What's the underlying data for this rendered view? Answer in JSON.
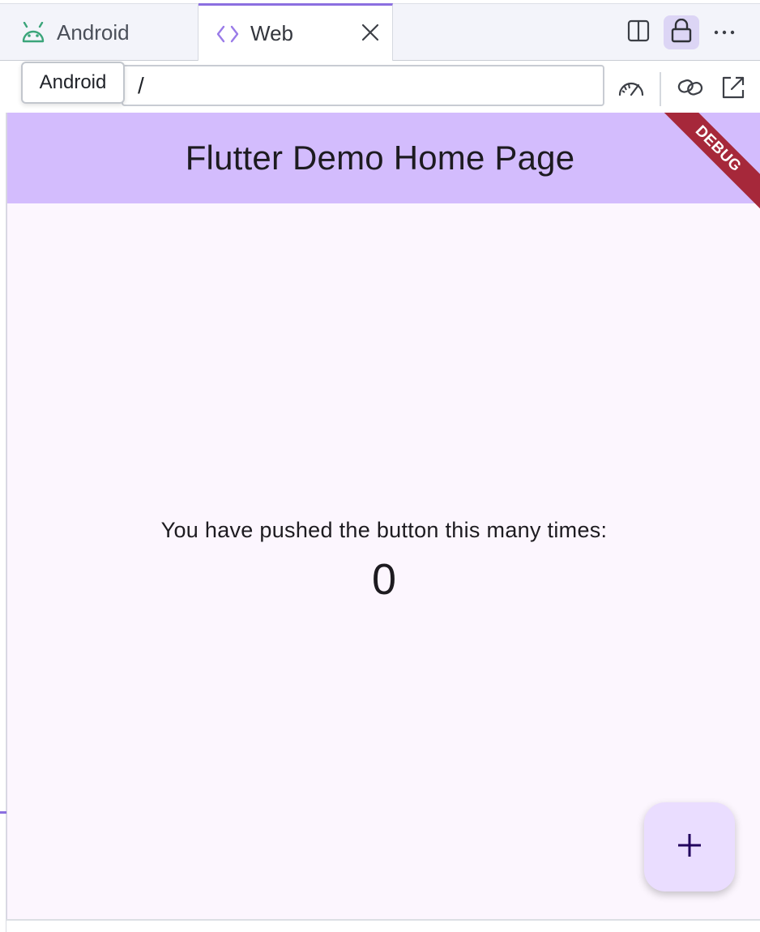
{
  "tabs": [
    {
      "label": "Android",
      "icon": "android-icon",
      "active": false
    },
    {
      "label": "Web",
      "icon": "code-brackets-icon",
      "active": true
    }
  ],
  "toolbar": {
    "icons": [
      "split-view-icon",
      "lock-icon",
      "more-horizontal-icon"
    ]
  },
  "tooltip": {
    "text": "Android"
  },
  "address": {
    "value": "/"
  },
  "address_icons": [
    "performance-gauge-icon",
    "link-icon",
    "open-external-icon"
  ],
  "app": {
    "title": "Flutter Demo Home Page",
    "debug_banner": "DEBUG",
    "counter_label": "You have pushed the button this many times:",
    "counter_value": "0",
    "fab_icon": "plus-icon"
  },
  "colors": {
    "accent": "#8b6fe0",
    "appbar": "#d3bcfd",
    "background": "#fcf6fe",
    "fab": "#eaddff",
    "debug": "#a6283a",
    "android_green": "#3ddc84"
  }
}
